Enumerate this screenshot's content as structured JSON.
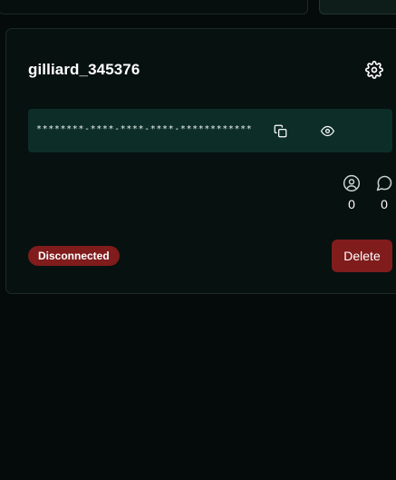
{
  "card": {
    "title": "gilliard_345376",
    "api_key_masked": "********-****-****-****-************",
    "stats": {
      "users_count": "0",
      "chats_count": "0"
    },
    "status": "Disconnected",
    "delete_label": "Delete"
  },
  "icons": {
    "settings": "gear-icon",
    "copy": "copy-icon",
    "reveal": "eye-icon",
    "users": "user-circle-icon",
    "chats": "message-circle-icon"
  },
  "colors": {
    "background": "#050b0a",
    "card": "#071110",
    "key_box": "#0d2e28",
    "danger": "#801c1c"
  }
}
